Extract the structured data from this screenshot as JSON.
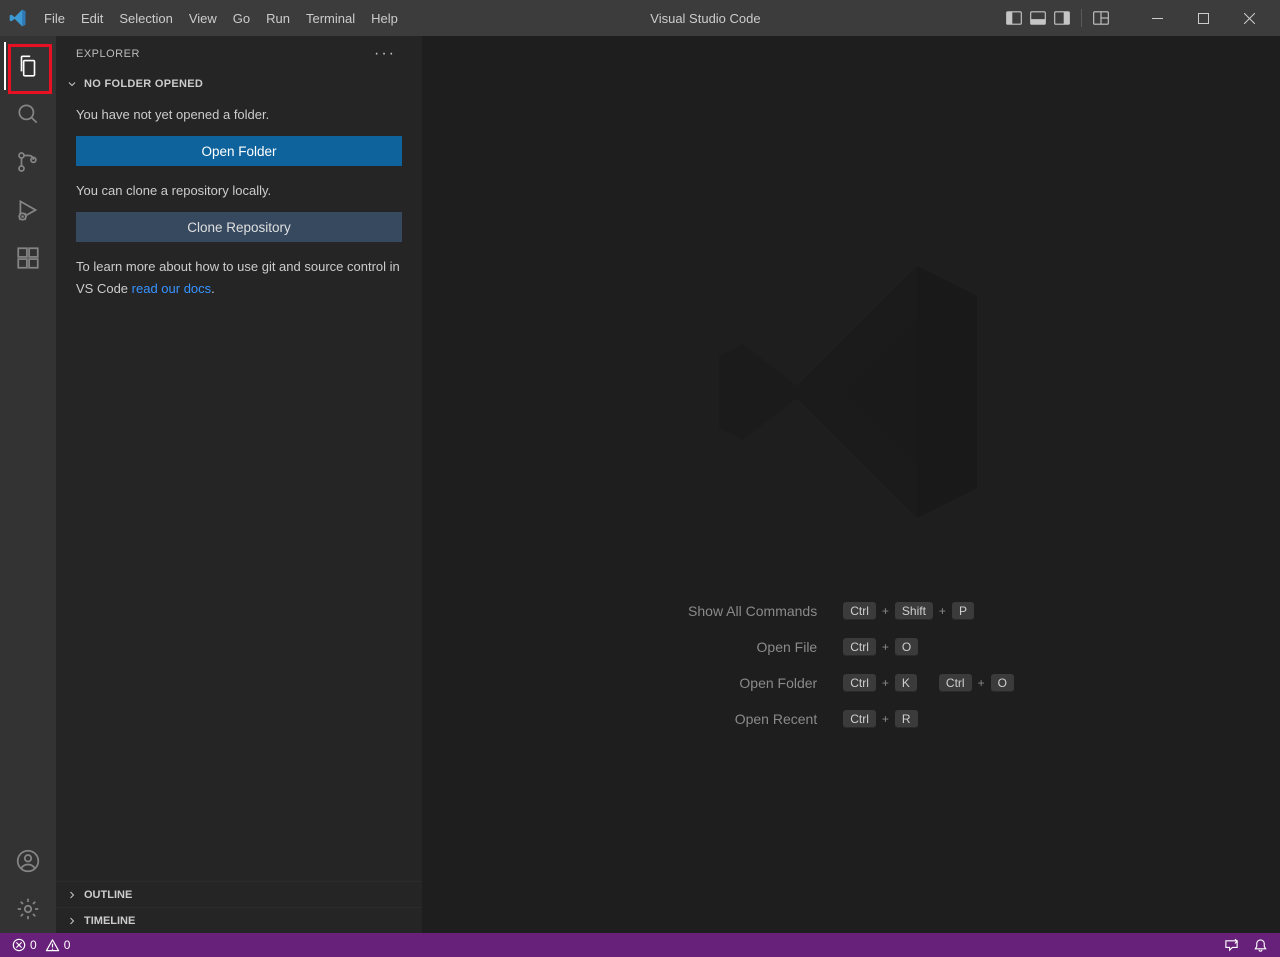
{
  "titlebar": {
    "menu": [
      "File",
      "Edit",
      "Selection",
      "View",
      "Go",
      "Run",
      "Terminal",
      "Help"
    ],
    "title": "Visual Studio Code"
  },
  "activity": {
    "items": [
      "explorer",
      "search",
      "source-control",
      "run-debug",
      "extensions"
    ],
    "bottom": [
      "accounts",
      "settings"
    ]
  },
  "sidebar": {
    "title": "EXPLORER",
    "no_folder": {
      "header": "No Folder Opened",
      "msg1": "You have not yet opened a folder.",
      "open_folder_btn": "Open Folder",
      "msg2": "You can clone a repository locally.",
      "clone_btn": "Clone Repository",
      "msg3a": "To learn more about how to use git and source control in VS Code ",
      "msg3link": "read our docs",
      "msg3b": "."
    },
    "outline": "Outline",
    "timeline": "Timeline"
  },
  "shortcuts": [
    {
      "label": "Show All Commands",
      "keys": [
        [
          "Ctrl",
          "Shift",
          "P"
        ]
      ]
    },
    {
      "label": "Open File",
      "keys": [
        [
          "Ctrl",
          "O"
        ]
      ]
    },
    {
      "label": "Open Folder",
      "keys": [
        [
          "Ctrl",
          "K"
        ],
        [
          "Ctrl",
          "O"
        ]
      ]
    },
    {
      "label": "Open Recent",
      "keys": [
        [
          "Ctrl",
          "R"
        ]
      ]
    }
  ],
  "status": {
    "errors": "0",
    "warnings": "0"
  }
}
